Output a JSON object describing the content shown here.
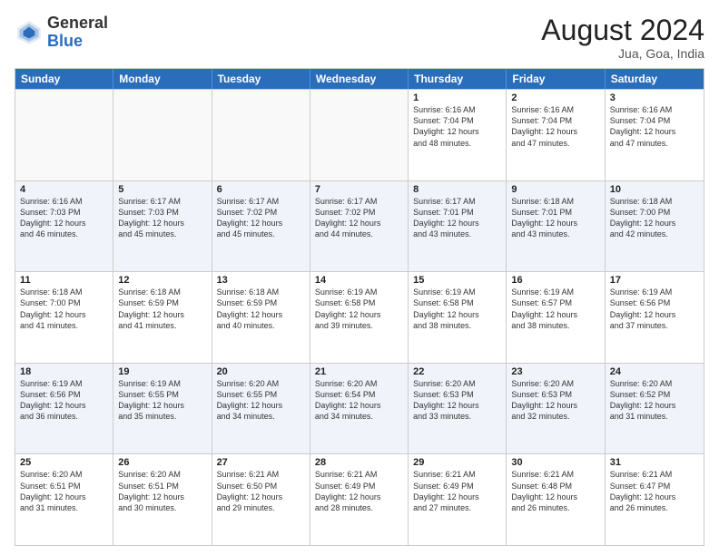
{
  "header": {
    "logo_general": "General",
    "logo_blue": "Blue",
    "month_year": "August 2024",
    "location": "Jua, Goa, India"
  },
  "weekdays": [
    "Sunday",
    "Monday",
    "Tuesday",
    "Wednesday",
    "Thursday",
    "Friday",
    "Saturday"
  ],
  "rows": [
    [
      {
        "day": "",
        "info": ""
      },
      {
        "day": "",
        "info": ""
      },
      {
        "day": "",
        "info": ""
      },
      {
        "day": "",
        "info": ""
      },
      {
        "day": "1",
        "info": "Sunrise: 6:16 AM\nSunset: 7:04 PM\nDaylight: 12 hours\nand 48 minutes."
      },
      {
        "day": "2",
        "info": "Sunrise: 6:16 AM\nSunset: 7:04 PM\nDaylight: 12 hours\nand 47 minutes."
      },
      {
        "day": "3",
        "info": "Sunrise: 6:16 AM\nSunset: 7:04 PM\nDaylight: 12 hours\nand 47 minutes."
      }
    ],
    [
      {
        "day": "4",
        "info": "Sunrise: 6:16 AM\nSunset: 7:03 PM\nDaylight: 12 hours\nand 46 minutes."
      },
      {
        "day": "5",
        "info": "Sunrise: 6:17 AM\nSunset: 7:03 PM\nDaylight: 12 hours\nand 45 minutes."
      },
      {
        "day": "6",
        "info": "Sunrise: 6:17 AM\nSunset: 7:02 PM\nDaylight: 12 hours\nand 45 minutes."
      },
      {
        "day": "7",
        "info": "Sunrise: 6:17 AM\nSunset: 7:02 PM\nDaylight: 12 hours\nand 44 minutes."
      },
      {
        "day": "8",
        "info": "Sunrise: 6:17 AM\nSunset: 7:01 PM\nDaylight: 12 hours\nand 43 minutes."
      },
      {
        "day": "9",
        "info": "Sunrise: 6:18 AM\nSunset: 7:01 PM\nDaylight: 12 hours\nand 43 minutes."
      },
      {
        "day": "10",
        "info": "Sunrise: 6:18 AM\nSunset: 7:00 PM\nDaylight: 12 hours\nand 42 minutes."
      }
    ],
    [
      {
        "day": "11",
        "info": "Sunrise: 6:18 AM\nSunset: 7:00 PM\nDaylight: 12 hours\nand 41 minutes."
      },
      {
        "day": "12",
        "info": "Sunrise: 6:18 AM\nSunset: 6:59 PM\nDaylight: 12 hours\nand 41 minutes."
      },
      {
        "day": "13",
        "info": "Sunrise: 6:18 AM\nSunset: 6:59 PM\nDaylight: 12 hours\nand 40 minutes."
      },
      {
        "day": "14",
        "info": "Sunrise: 6:19 AM\nSunset: 6:58 PM\nDaylight: 12 hours\nand 39 minutes."
      },
      {
        "day": "15",
        "info": "Sunrise: 6:19 AM\nSunset: 6:58 PM\nDaylight: 12 hours\nand 38 minutes."
      },
      {
        "day": "16",
        "info": "Sunrise: 6:19 AM\nSunset: 6:57 PM\nDaylight: 12 hours\nand 38 minutes."
      },
      {
        "day": "17",
        "info": "Sunrise: 6:19 AM\nSunset: 6:56 PM\nDaylight: 12 hours\nand 37 minutes."
      }
    ],
    [
      {
        "day": "18",
        "info": "Sunrise: 6:19 AM\nSunset: 6:56 PM\nDaylight: 12 hours\nand 36 minutes."
      },
      {
        "day": "19",
        "info": "Sunrise: 6:19 AM\nSunset: 6:55 PM\nDaylight: 12 hours\nand 35 minutes."
      },
      {
        "day": "20",
        "info": "Sunrise: 6:20 AM\nSunset: 6:55 PM\nDaylight: 12 hours\nand 34 minutes."
      },
      {
        "day": "21",
        "info": "Sunrise: 6:20 AM\nSunset: 6:54 PM\nDaylight: 12 hours\nand 34 minutes."
      },
      {
        "day": "22",
        "info": "Sunrise: 6:20 AM\nSunset: 6:53 PM\nDaylight: 12 hours\nand 33 minutes."
      },
      {
        "day": "23",
        "info": "Sunrise: 6:20 AM\nSunset: 6:53 PM\nDaylight: 12 hours\nand 32 minutes."
      },
      {
        "day": "24",
        "info": "Sunrise: 6:20 AM\nSunset: 6:52 PM\nDaylight: 12 hours\nand 31 minutes."
      }
    ],
    [
      {
        "day": "25",
        "info": "Sunrise: 6:20 AM\nSunset: 6:51 PM\nDaylight: 12 hours\nand 31 minutes."
      },
      {
        "day": "26",
        "info": "Sunrise: 6:20 AM\nSunset: 6:51 PM\nDaylight: 12 hours\nand 30 minutes."
      },
      {
        "day": "27",
        "info": "Sunrise: 6:21 AM\nSunset: 6:50 PM\nDaylight: 12 hours\nand 29 minutes."
      },
      {
        "day": "28",
        "info": "Sunrise: 6:21 AM\nSunset: 6:49 PM\nDaylight: 12 hours\nand 28 minutes."
      },
      {
        "day": "29",
        "info": "Sunrise: 6:21 AM\nSunset: 6:49 PM\nDaylight: 12 hours\nand 27 minutes."
      },
      {
        "day": "30",
        "info": "Sunrise: 6:21 AM\nSunset: 6:48 PM\nDaylight: 12 hours\nand 26 minutes."
      },
      {
        "day": "31",
        "info": "Sunrise: 6:21 AM\nSunset: 6:47 PM\nDaylight: 12 hours\nand 26 minutes."
      }
    ]
  ]
}
